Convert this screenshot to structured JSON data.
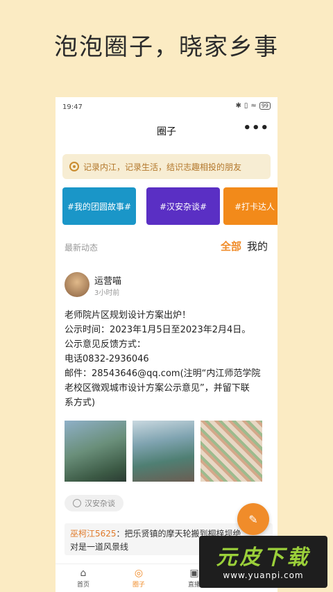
{
  "promo": {
    "title": "泡泡圈子，晓家乡事"
  },
  "status": {
    "time": "19:47",
    "battery": "99"
  },
  "nav": {
    "title": "圈子",
    "more": "•••"
  },
  "notice": {
    "text": "记录内江，记录生活，结识志趣相投的朋友"
  },
  "topics": [
    {
      "label": "#我的团圆故事#",
      "color": "#1a96c8"
    },
    {
      "label": "#汉安杂谈#",
      "color": "#5a2fc4"
    },
    {
      "label": "#打卡达人",
      "color": "#f28a1a"
    }
  ],
  "feed": {
    "section_label": "最新动态",
    "tab_all": "全部",
    "tab_mine": "我的"
  },
  "post": {
    "user": "运营喵",
    "time": "3小时前",
    "lines": [
      "老师院片区规划设计方案出炉！",
      "公示时间：2023年1月5日至2023年2月4日。",
      "公示意见反馈方式：",
      "电话0832-2936046",
      "邮件：28543646@qq.com(注明“内江师范学院",
      "老校区微观城市设计方案公示意见”，并留下联",
      "系方式)"
    ],
    "tag": "汉安杂谈",
    "comment": {
      "author": "巫柯江5625",
      "line1": "：把乐贤镇的摩天轮搬到桐梓坝绝",
      "line2": "对是一道风景线"
    }
  },
  "tabbar": {
    "home": "首页",
    "circle": "圈子",
    "live": "直播"
  },
  "colors": {
    "accent": "#f08c2a",
    "background": "#fbebc3"
  },
  "watermark": {
    "brand": "元皮下载",
    "url": "www.yuanpi.com"
  }
}
